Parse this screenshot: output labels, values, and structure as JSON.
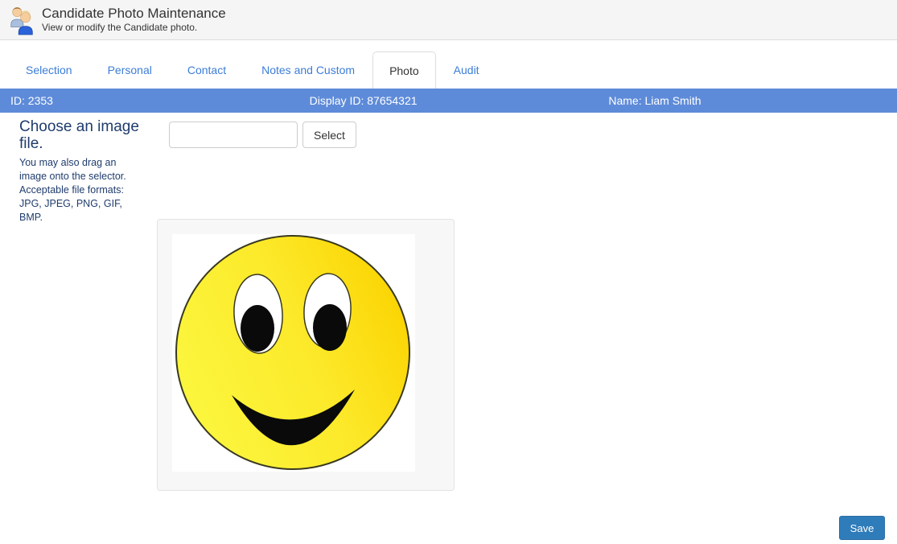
{
  "header": {
    "title": "Candidate Photo Maintenance",
    "subtitle": "View or modify the Candidate photo.",
    "icon": "users-icon"
  },
  "tabs": [
    {
      "label": "Selection",
      "active": false
    },
    {
      "label": "Personal",
      "active": false
    },
    {
      "label": "Contact",
      "active": false
    },
    {
      "label": "Notes and Custom",
      "active": false
    },
    {
      "label": "Photo",
      "active": true
    },
    {
      "label": "Audit",
      "active": false
    }
  ],
  "record_bar": {
    "id": "ID: 2353",
    "display_id": "Display ID: 87654321",
    "name": "Name: Liam Smith"
  },
  "uploader": {
    "heading": "Choose an image file.",
    "help_drag": "You may also drag an image onto the selector.",
    "help_formats": "Acceptable file formats: JPG, JPEG, PNG, GIF, BMP.",
    "file_input_value": "",
    "select_button": "Select"
  },
  "photo": {
    "image_description": "yellow smiley face on white background"
  },
  "footer": {
    "save_label": "Save"
  },
  "colors": {
    "header_background": "#f5f5f5",
    "accent_bar": "#5e8bd9",
    "tab_link": "#3c7dd7",
    "instruction_text": "#1f3c6d",
    "save_button": "#2f7cba",
    "smiley_yellow": "#fbd300"
  }
}
